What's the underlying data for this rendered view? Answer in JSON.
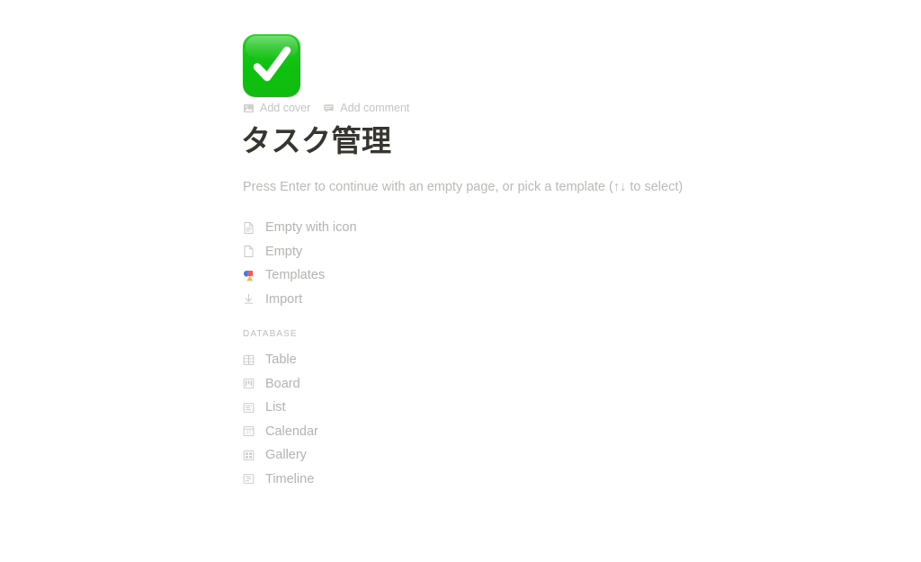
{
  "page": {
    "icon": "green-check-emoji",
    "icon_colors": {
      "background": "#13c213",
      "check": "#ffffff"
    },
    "title": "タスク管理"
  },
  "meta_actions": [
    {
      "label": "Add cover",
      "icon": "image-icon"
    },
    {
      "label": "Add comment",
      "icon": "comment-icon"
    }
  ],
  "hint": "Press Enter to continue with an empty page, or pick a template (↑↓ to select)",
  "primary_menu": {
    "items": [
      {
        "label": "Empty with icon",
        "icon": "document-lines-icon"
      },
      {
        "label": "Empty",
        "icon": "document-blank-icon"
      },
      {
        "label": "Templates",
        "icon": "templates-shapes-icon"
      },
      {
        "label": "Import",
        "icon": "import-download-icon"
      }
    ]
  },
  "database_menu": {
    "section_label": "DATABASE",
    "items": [
      {
        "label": "Table",
        "icon": "table-grid-icon"
      },
      {
        "label": "Board",
        "icon": "board-columns-icon"
      },
      {
        "label": "List",
        "icon": "list-lines-icon"
      },
      {
        "label": "Calendar",
        "icon": "calendar-31-icon",
        "icon_text": "31"
      },
      {
        "label": "Gallery",
        "icon": "gallery-tiles-icon"
      },
      {
        "label": "Timeline",
        "icon": "timeline-bars-icon"
      }
    ]
  },
  "colors": {
    "background": "#ffffff",
    "title_text": "#37352f",
    "muted_text": "#b3b3b1",
    "icon_stroke": "#c9c9c7",
    "accent_green": "#13c213",
    "templates_blue": "#2d7ff9",
    "templates_red": "#f05a5a",
    "templates_yellow": "#f6ba3e"
  }
}
